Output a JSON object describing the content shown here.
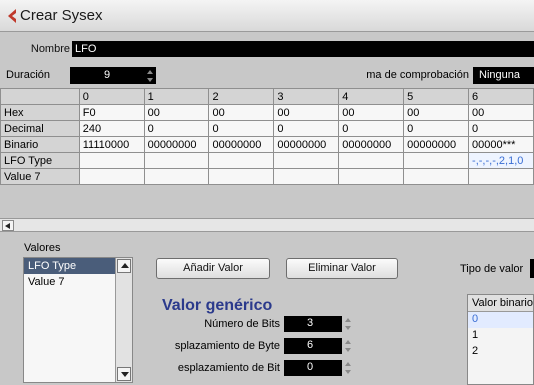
{
  "window": {
    "title": "Crear Sysex",
    "accent_color": "#c0392b",
    "title_color": "#2b3a8c"
  },
  "name": {
    "label": "Nombre",
    "value": "LFO"
  },
  "duration": {
    "label": "Duración",
    "value": "9"
  },
  "checksum": {
    "label": "ma de comprobación",
    "value": "Ninguna"
  },
  "grid": {
    "columns": [
      "",
      "0",
      "1",
      "2",
      "3",
      "4",
      "5",
      "6"
    ],
    "rows": [
      {
        "label": "Hex",
        "cells": [
          "F0",
          "00",
          "00",
          "00",
          "00",
          "00",
          "00"
        ]
      },
      {
        "label": "Decimal",
        "cells": [
          "240",
          "0",
          "0",
          "0",
          "0",
          "0",
          "0"
        ]
      },
      {
        "label": "Binario",
        "cells": [
          "11110000",
          "00000000",
          "00000000",
          "00000000",
          "00000000",
          "00000000",
          "00000***"
        ]
      },
      {
        "label": "LFO Type",
        "cells": [
          "",
          "",
          "",
          "",
          "",
          "",
          "-,-,-,-,2,1,0"
        ]
      },
      {
        "label": "Value 7",
        "cells": [
          "",
          "",
          "",
          "",
          "",
          "",
          ""
        ]
      }
    ]
  },
  "values": {
    "label": "Valores",
    "items": [
      "LFO Type",
      "Value 7"
    ]
  },
  "buttons": {
    "add": "Añadir Valor",
    "remove": "Eliminar Valor"
  },
  "value_type": {
    "label": "Tipo de valor",
    "value": ""
  },
  "generic": {
    "title": "Valor genérico",
    "bits": {
      "label": "Número de Bits",
      "value": "3"
    },
    "byte_offset": {
      "label": "splazamiento de Byte",
      "value": "6"
    },
    "bit_offset": {
      "label": "esplazamiento de Bit",
      "value": "0"
    }
  },
  "binary_values": {
    "header": "Valor binario",
    "items": [
      "0",
      "1",
      "2"
    ]
  }
}
